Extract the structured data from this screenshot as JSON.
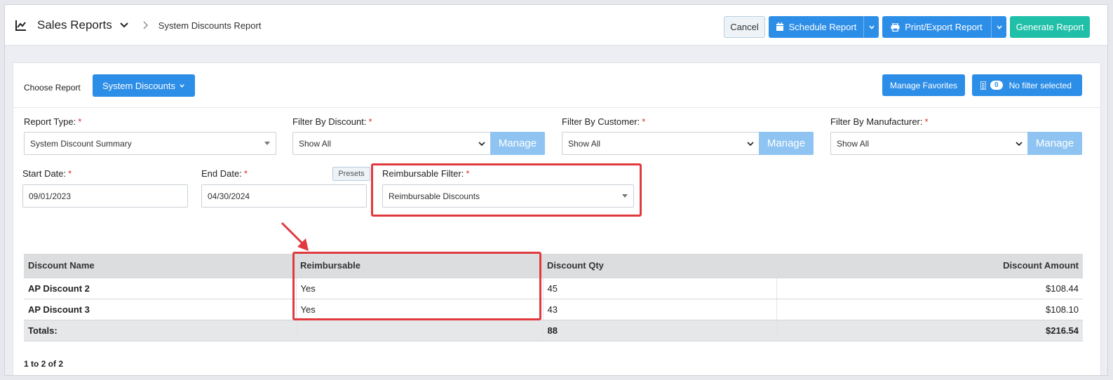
{
  "header": {
    "app_title": "Sales Reports",
    "breadcrumb": "System Discounts Report",
    "cancel_label": "Cancel",
    "schedule_label": "Schedule Report",
    "print_label": "Print/Export Report",
    "generate_label": "Generate Report"
  },
  "toolbar": {
    "choose_label": "Choose Report",
    "choose_value": "System Discounts",
    "favorites_label": "Manage Favorites",
    "filter_count": "0",
    "filter_label": "No filter selected"
  },
  "filters": {
    "report_type": {
      "label": "Report Type:",
      "value": "System Discount Summary"
    },
    "discount": {
      "label": "Filter By Discount:",
      "value": "Show All",
      "manage": "Manage"
    },
    "customer": {
      "label": "Filter By Customer:",
      "value": "Show All",
      "manage": "Manage"
    },
    "manufacturer": {
      "label": "Filter By Manufacturer:",
      "value": "Show All",
      "manage": "Manage"
    },
    "start_date": {
      "label": "Start Date:",
      "value": "09/01/2023"
    },
    "end_date": {
      "label": "End Date:",
      "value": "04/30/2024"
    },
    "presets_label": "Presets",
    "reimbursable": {
      "label": "Reimbursable Filter:",
      "value": "Reimbursable Discounts"
    },
    "required_mark": "*"
  },
  "table": {
    "columns": [
      "Discount Name",
      "Reimbursable",
      "Discount Qty",
      "Discount Amount"
    ],
    "rows": [
      {
        "name": "AP Discount 2",
        "reimbursable": "Yes",
        "qty": "45",
        "amount": "$108.44"
      },
      {
        "name": "AP Discount 3",
        "reimbursable": "Yes",
        "qty": "43",
        "amount": "$108.10"
      }
    ],
    "totals": {
      "label": "Totals:",
      "reimbursable": "",
      "qty": "88",
      "amount": "$216.54"
    }
  },
  "pager": {
    "text": "1 to 2 of 2"
  },
  "colors": {
    "primary": "#2d8ee8",
    "teal": "#1fbfa8",
    "manage": "#8fc4f2",
    "highlight": "#e03a3e",
    "required": "#d9302c"
  }
}
